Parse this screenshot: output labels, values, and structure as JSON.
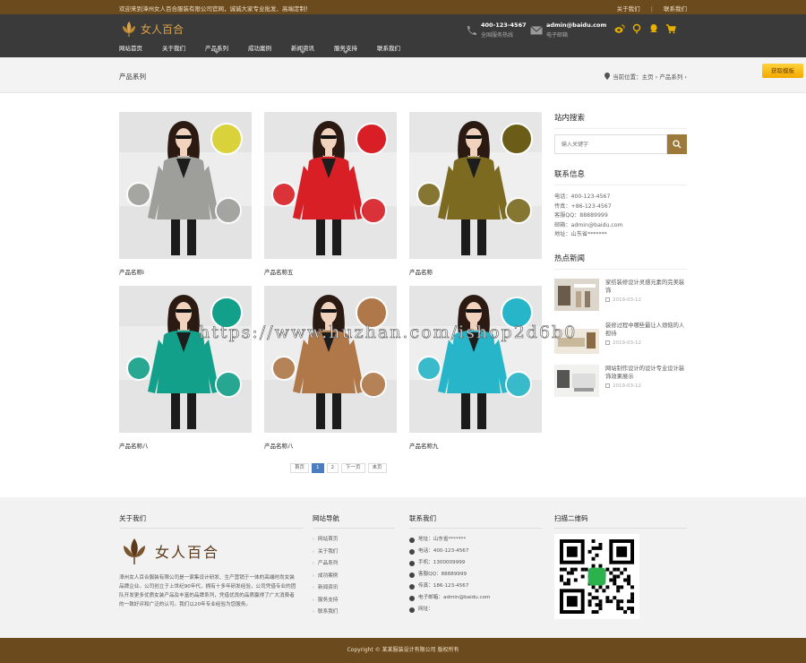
{
  "topbar": {
    "welcome": "欢迎来到漳州女人百合服装有限公司官网，诚诚大家专业批发、高端定制！",
    "about_link": "关于我们",
    "separator": "|",
    "contact_link": "联系我们"
  },
  "header": {
    "logo_text": "女人百合",
    "phone": "400-123-4567",
    "phone_note": "全国服务热线",
    "email": "admin@baidu.com",
    "email_note": "电子邮箱",
    "nav": [
      {
        "label": "网站首页",
        "dropdown": false
      },
      {
        "label": "关于我们",
        "dropdown": false
      },
      {
        "label": "产品系列",
        "dropdown": true
      },
      {
        "label": "成功案例",
        "dropdown": false
      },
      {
        "label": "新闻资讯",
        "dropdown": true
      },
      {
        "label": "服务支持",
        "dropdown": true
      },
      {
        "label": "联系我们",
        "dropdown": false
      }
    ]
  },
  "breadcrumb": {
    "title": "产品系列",
    "location": "当前位置：主页 › 产品系列 ›",
    "template_button": "获取模板"
  },
  "products": [
    {
      "caption": "产品名称Ⅰ",
      "coat": "#9e9e9a",
      "accent": "#d9d23a",
      "bg": "#e3e3e3"
    },
    {
      "caption": "产品名称五",
      "coat": "#d81f26",
      "accent": "#d81f26",
      "bg": "#e5e5e5"
    },
    {
      "caption": "产品名称",
      "coat": "#7b6a1f",
      "accent": "#6b5c18",
      "bg": "#e6e6e6"
    },
    {
      "caption": "产品名称八",
      "coat": "#13a08a",
      "accent": "#13a08a",
      "bg": "#e4e4e4"
    },
    {
      "caption": "产品名称八",
      "coat": "#b07848",
      "accent": "#b07848",
      "bg": "#e4e4e4"
    },
    {
      "caption": "产品名称九",
      "coat": "#27b6c9",
      "accent": "#27b6c9",
      "bg": "#e5e5e5"
    }
  ],
  "pager": {
    "first": "首页",
    "pages": [
      "1",
      "2"
    ],
    "current": "1",
    "next": "下一页",
    "last": "末页"
  },
  "sidebar": {
    "search_title": "站内搜索",
    "search_placeholder": "输入关键字",
    "contact_title": "联系信息",
    "contact_lines": [
      "电话：400-123-4567",
      "传真：+86-123-4567",
      "客服QQ：88889999",
      "邮箱：admin@baidu.com",
      "地址：山东省*******"
    ],
    "news_title": "热点新闻",
    "news": [
      {
        "title": "家纺装修设计灵感元素的完美装饰",
        "date": "2019-03-12"
      },
      {
        "title": "装修过程中哪些最让人烦恼的人担待",
        "date": "2019-03-12"
      },
      {
        "title": "网站制作设计的设计专业设计装饰效果展示",
        "date": "2019-03-12"
      }
    ]
  },
  "footer": {
    "about_title": "关于我们",
    "about_logo_text": "女人百合",
    "about_text": "漳州女人百合服装有限公司是一家集设计研发、生产营销于一体的高端时尚女装品牌企业。公司创立于上世纪90年代，拥有十多年研发经验，公司凭借专业的团队开发更多优质女装产品及丰富的品牌系列，凭借优良的品质赢得了广大消费者的一致好评和广泛的认可。我们以20年专业经验为您服务。",
    "nav_title": "网站导航",
    "nav_links": [
      "网站首页",
      "关于我们",
      "产品系列",
      "成功案例",
      "新闻资讯",
      "服务支持",
      "联系我们"
    ],
    "contact_title": "联系我们",
    "contact_lines": [
      "地址：山东省*******",
      "电话：400-123-4567",
      "手机：1300009999",
      "客服QQ：88889999",
      "传真：186-123-4567",
      "电子邮箱：admin@baidu.com",
      "网址："
    ],
    "qr_title": "扫描二维码",
    "copyright": "Copyright © 某某服装设计有限公司 版权所有"
  },
  "watermark": "https://www.huzhan.com/ishop2d6b0",
  "colors": {
    "brand_brown": "#6b4a1e",
    "header_dark": "#3a3a3a",
    "gold": "#d9a24b",
    "active_page": "#4a7cc0"
  }
}
